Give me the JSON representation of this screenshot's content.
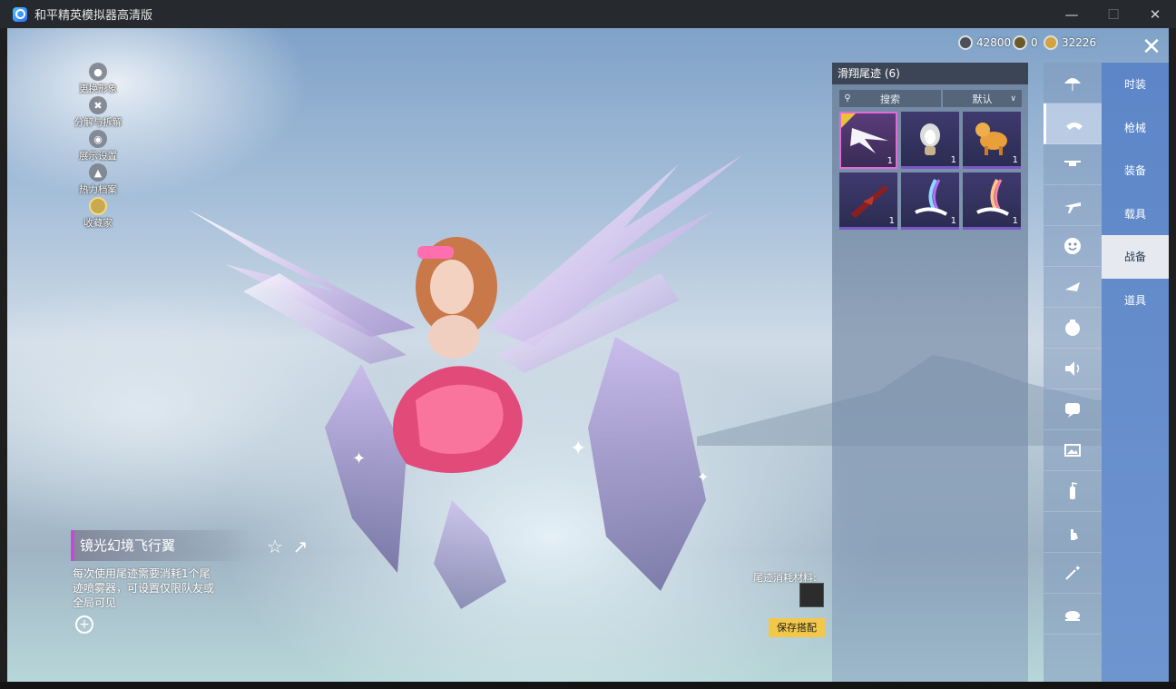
{
  "window": {
    "title": "和平精英模拟器高清版"
  },
  "currency": [
    {
      "name": "coin-1",
      "value": "42800"
    },
    {
      "name": "coin-2",
      "value": "0"
    },
    {
      "name": "coin-3",
      "value": "32226"
    }
  ],
  "left_menu": [
    {
      "label": "更换形象",
      "icon": "user-icon"
    },
    {
      "label": "分解与拆解",
      "icon": "wrench-icon"
    },
    {
      "label": "展示设置",
      "icon": "eye-icon"
    },
    {
      "label": "热力档案",
      "icon": "flame-icon"
    },
    {
      "label": "收藏家",
      "icon": "badge-icon"
    }
  ],
  "item": {
    "name": "镜光幻境飞行翼",
    "description": "每次使用尾迹需要消耗1个尾迹喷雾器，可设置仅限队友或全局可见"
  },
  "panel": {
    "title": "滑翔尾迹 (6)",
    "search_placeholder": "搜索",
    "sort_label": "默认",
    "consume_label": "尾迹消耗材料:",
    "save_label": "保存搭配",
    "items": [
      {
        "qty": "1",
        "icon": "wings-icon",
        "selected": true
      },
      {
        "qty": "1",
        "icon": "penguin-icon",
        "selected": false
      },
      {
        "qty": "1",
        "icon": "horse-icon",
        "selected": false
      },
      {
        "qty": "1",
        "icon": "rifle-icon",
        "selected": false
      },
      {
        "qty": "1",
        "icon": "rainbow-trail-icon",
        "selected": false
      },
      {
        "qty": "1",
        "icon": "rainbow-trail-icon",
        "selected": false
      }
    ]
  },
  "right_nav": [
    "时装",
    "枪械",
    "装备",
    "载具",
    "战备",
    "道具"
  ],
  "right_nav_active": "战备",
  "colors": {
    "accent": "#f3c84a",
    "nav": "#5c86c8",
    "selected": "#e26bd8"
  }
}
